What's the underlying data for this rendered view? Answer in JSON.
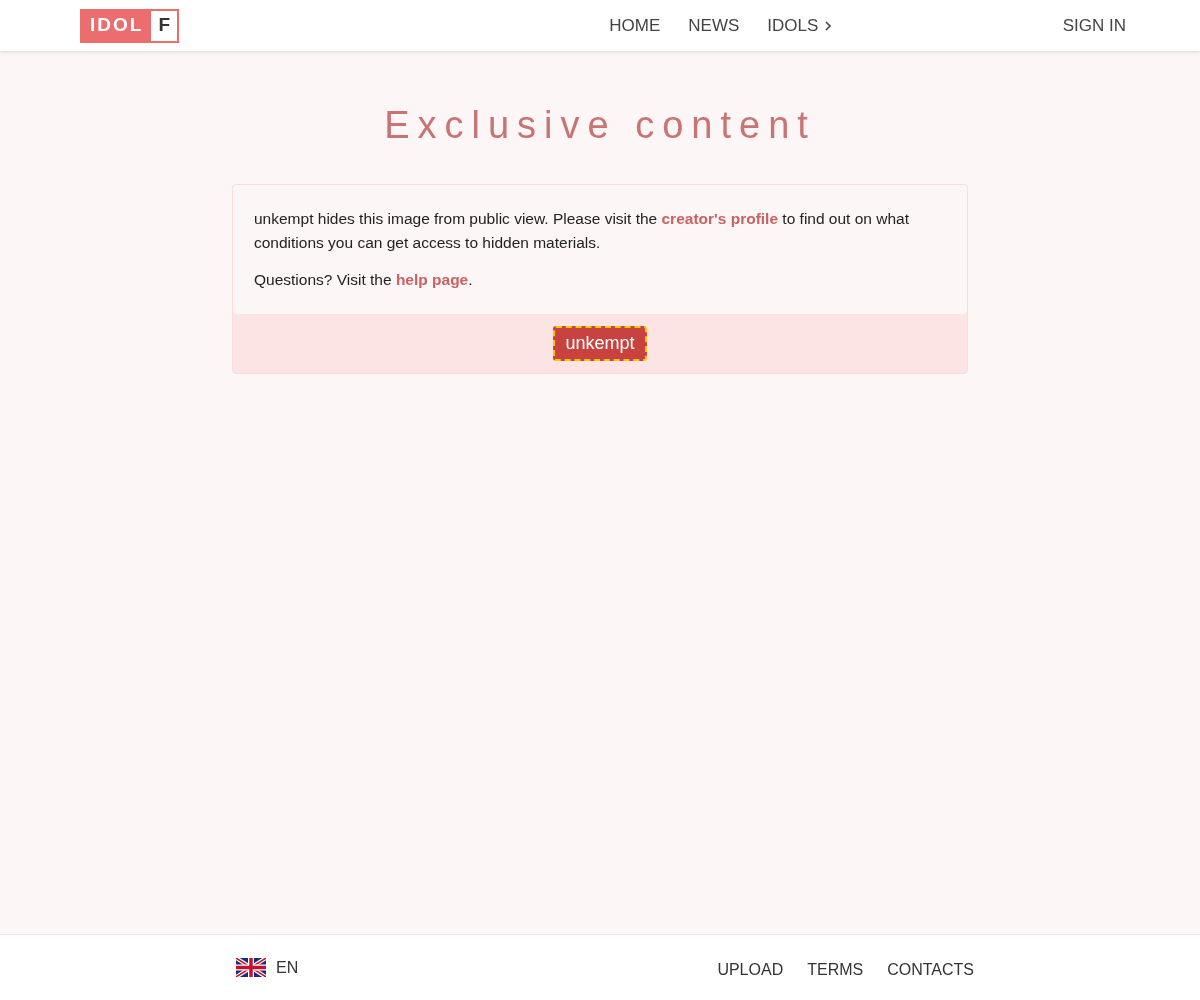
{
  "header": {
    "logo": {
      "left": "IDOL",
      "right": "F"
    },
    "nav": [
      {
        "label": "HOME",
        "caret": false
      },
      {
        "label": "NEWS",
        "caret": false
      },
      {
        "label": "IDOLS",
        "caret": true
      }
    ],
    "sign_in": "SIGN IN"
  },
  "title": "Exclusive content",
  "notice": {
    "paragraphs": [
      [
        {
          "kind": "text",
          "text": "unkempt hides this image from public view. Please visit the "
        },
        {
          "kind": "link",
          "text": "creator's profile"
        },
        {
          "kind": "text",
          "text": " to find out on what conditions you can get access to hidden materials."
        }
      ],
      [
        {
          "kind": "text",
          "text": "Questions? Visit the "
        },
        {
          "kind": "link",
          "text": "help page"
        },
        {
          "kind": "text",
          "text": "."
        }
      ]
    ],
    "creator_button": "unkempt"
  },
  "footer": {
    "language": "EN",
    "links": [
      "UPLOAD",
      "TERMS",
      "CONTACTS"
    ]
  }
}
